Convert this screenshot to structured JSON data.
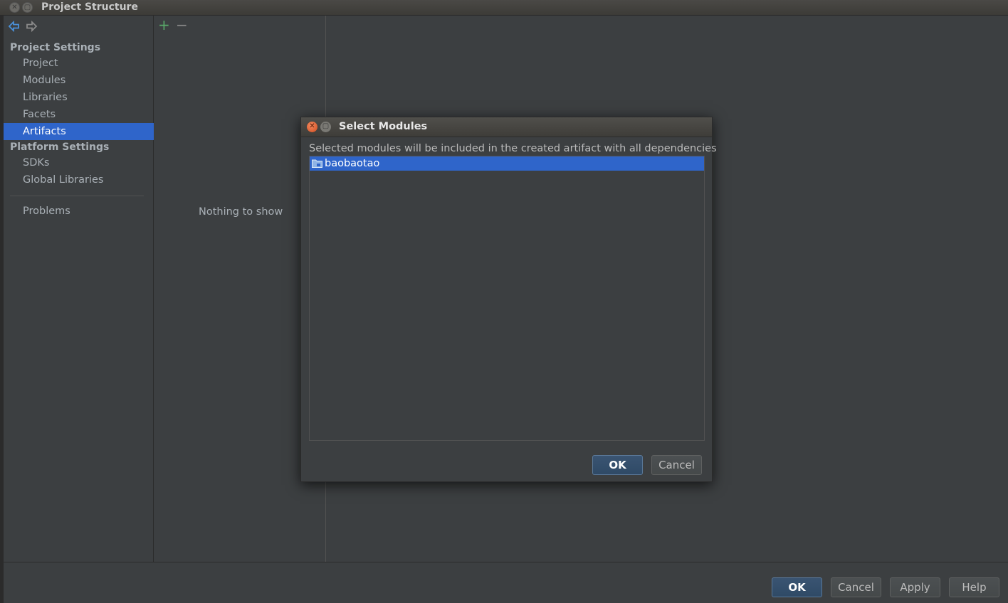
{
  "window": {
    "title": "Project Structure"
  },
  "sidebar": {
    "project_settings_header": "Project Settings",
    "project_items": [
      {
        "label": "Project"
      },
      {
        "label": "Modules"
      },
      {
        "label": "Libraries"
      },
      {
        "label": "Facets"
      },
      {
        "label": "Artifacts",
        "selected": true
      }
    ],
    "platform_settings_header": "Platform Settings",
    "platform_items": [
      {
        "label": "SDKs"
      },
      {
        "label": "Global Libraries"
      }
    ],
    "problems_label": "Problems"
  },
  "artifacts_panel": {
    "add_icon": "+",
    "remove_icon": "−",
    "empty_text": "Nothing to show"
  },
  "dialog": {
    "title": "Select Modules",
    "description": "Selected modules will be included in the created artifact with all dependencies",
    "modules": [
      {
        "name": "baobaotao",
        "selected": true
      }
    ],
    "ok_label": "OK",
    "cancel_label": "Cancel"
  },
  "footer": {
    "ok_label": "OK",
    "cancel_label": "Cancel",
    "apply_label": "Apply",
    "help_label": "Help"
  },
  "colors": {
    "selection": "#2f65ca",
    "background": "#3c3f41",
    "add_green": "#59a869",
    "nav_blue": "#4a90d9"
  }
}
